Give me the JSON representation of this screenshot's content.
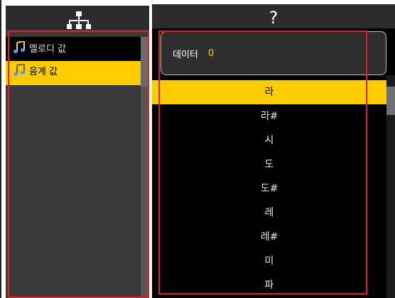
{
  "left_panel": {
    "header_icon": "hierarchy-icon",
    "items": [
      {
        "label": "멜로디 값",
        "icon": "music-note-icon",
        "selected": false
      },
      {
        "label": "음계 값",
        "icon": "music-note-icon",
        "selected": true
      }
    ]
  },
  "right_panel": {
    "header_title": "?",
    "data_field": {
      "label": "데이터",
      "value": "0"
    },
    "notes": [
      "라",
      "라#",
      "시",
      "도",
      "도#",
      "레",
      "레#",
      "미",
      "파"
    ],
    "selected_index": 0
  },
  "colors": {
    "accent": "#ffcc00",
    "highlight_border": "#e02020",
    "panel_bg": "#3a3a3a",
    "list_bg": "#000000"
  }
}
